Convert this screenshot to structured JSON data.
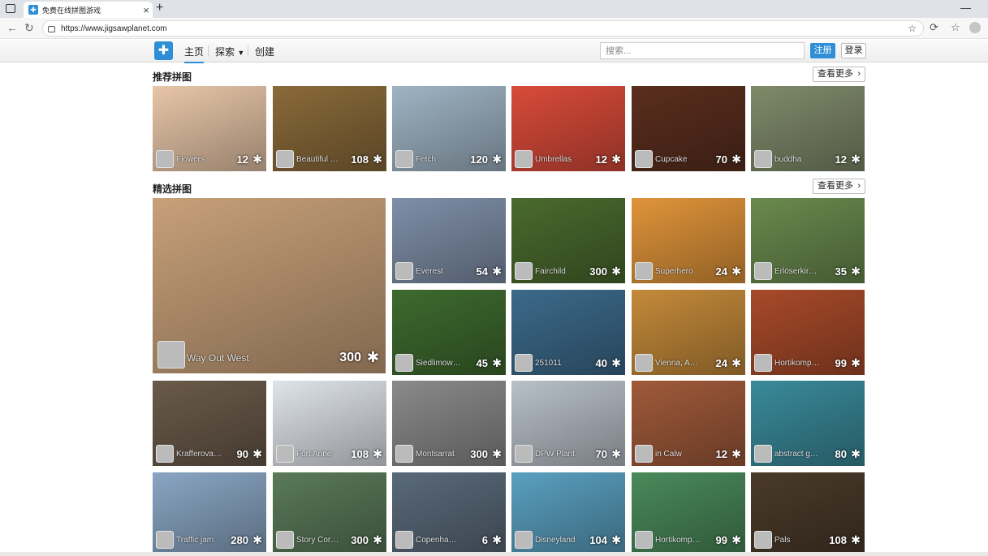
{
  "browser": {
    "tab_title": "免费在线拼图游戏",
    "url": "https://www.jigsawplanet.com"
  },
  "nav": {
    "home": "主页",
    "explore": "探索",
    "create": "创建",
    "search_placeholder": "搜索...",
    "register": "注册",
    "login": "登录"
  },
  "recommended": {
    "title": "推荐拼图",
    "more": "查看更多",
    "items": [
      {
        "name": "Flowers",
        "count": "12",
        "bg": "#e8c6a8"
      },
      {
        "name": "Beautiful horse",
        "count": "108",
        "bg": "#8a6a3a"
      },
      {
        "name": "Fetch",
        "count": "120",
        "bg": "#9fb4c4"
      },
      {
        "name": "Umbrellas",
        "count": "12",
        "bg": "#d94b3a"
      },
      {
        "name": "Cupcake",
        "count": "70",
        "bg": "#5a2e1e"
      },
      {
        "name": "buddha",
        "count": "12",
        "bg": "#7f8a6a"
      }
    ]
  },
  "featured": {
    "title": "精选拼图",
    "more": "查看更多",
    "big": {
      "name": "Way Out West",
      "count": "300",
      "bg": "#c7a079"
    },
    "items": [
      {
        "name": "Everest",
        "count": "54",
        "bg": "#7f8fa8"
      },
      {
        "name": "Fairchild",
        "count": "300",
        "bg": "#4a6a2e"
      },
      {
        "name": "Superhero",
        "count": "24",
        "bg": "#e0943a"
      },
      {
        "name": "Erlöserkirche",
        "count": "35",
        "bg": "#6a8a4e"
      },
      {
        "name": "Siedlimowice",
        "count": "45",
        "bg": "#3e6a2e"
      },
      {
        "name": "251011",
        "count": "40",
        "bg": "#3c6a8a"
      },
      {
        "name": "Vienna, Austria",
        "count": "24",
        "bg": "#c48a3a"
      },
      {
        "name": "Hortikomplex",
        "count": "99",
        "bg": "#a84a2a"
      },
      {
        "name": "Krafferova ulice",
        "count": "90",
        "bg": "#6a5a4a"
      },
      {
        "name": "Fort Anne",
        "count": "108",
        "bg": "#dfe4ea"
      },
      {
        "name": "Montsarrat",
        "count": "300",
        "bg": "#8a8a8a"
      },
      {
        "name": "DPW Plant",
        "count": "70",
        "bg": "#b8c0c8"
      },
      {
        "name": "in Calw",
        "count": "12",
        "bg": "#a05a3a"
      },
      {
        "name": "abstract geometry",
        "count": "80",
        "bg": "#3a8a9a"
      },
      {
        "name": "Traffic jam",
        "count": "280",
        "bg": "#8aa6c4"
      },
      {
        "name": "Story Corner",
        "count": "300",
        "bg": "#5a7a5a"
      },
      {
        "name": "Copenhagen",
        "count": "6",
        "bg": "#5a6a7a"
      },
      {
        "name": "Disneyland",
        "count": "104",
        "bg": "#5aa0c0"
      },
      {
        "name": "Hortikomplex",
        "count": "99",
        "bg": "#4a8a5a"
      },
      {
        "name": "Pals",
        "count": "108",
        "bg": "#4a3a2a"
      }
    ]
  }
}
